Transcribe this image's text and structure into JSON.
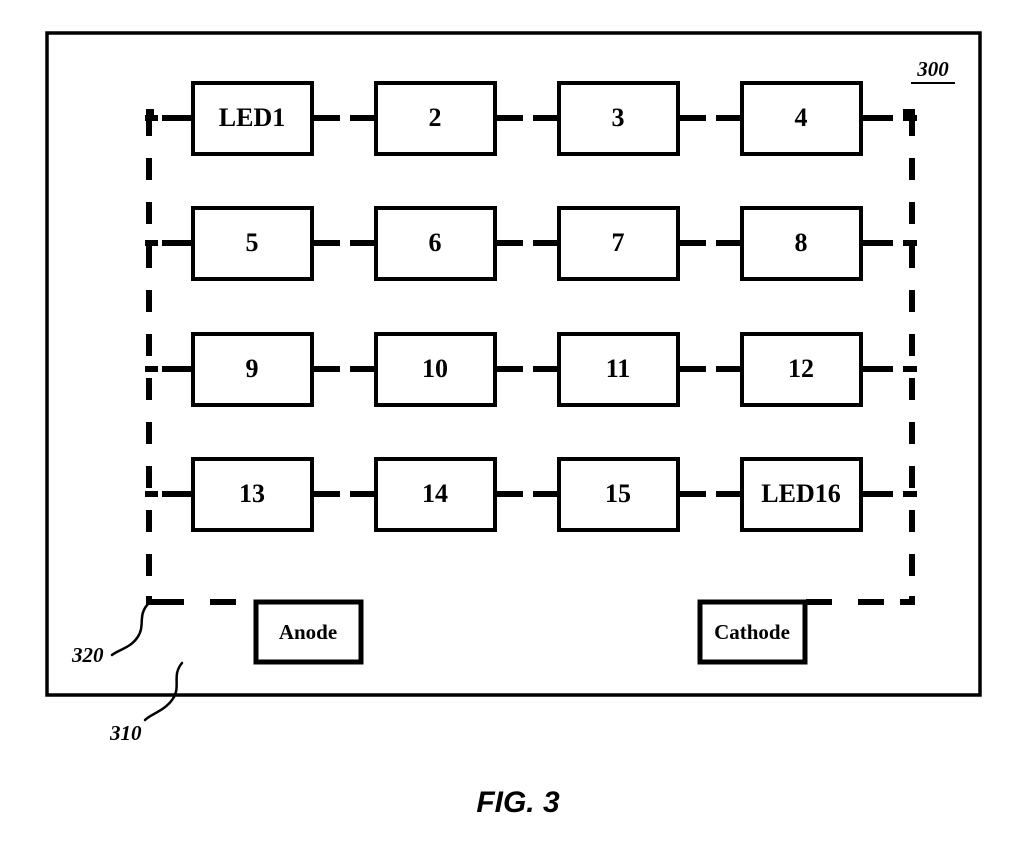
{
  "figure": {
    "caption": "FIG. 3",
    "assembly_ref": "300",
    "board_ref": "310",
    "circuit_ref": "320"
  },
  "led_array": {
    "rows": [
      [
        {
          "label": "LED1"
        },
        {
          "label": "2"
        },
        {
          "label": "3"
        },
        {
          "label": "4"
        }
      ],
      [
        {
          "label": "5"
        },
        {
          "label": "6"
        },
        {
          "label": "7"
        },
        {
          "label": "8"
        }
      ],
      [
        {
          "label": "9"
        },
        {
          "label": "10"
        },
        {
          "label": "11"
        },
        {
          "label": "12"
        }
      ],
      [
        {
          "label": "13"
        },
        {
          "label": "14"
        },
        {
          "label": "15"
        },
        {
          "label": "LED16"
        }
      ]
    ]
  },
  "terminals": {
    "anode": "Anode",
    "cathode": "Cathode"
  },
  "colors": {
    "line": "#000000",
    "background": "#ffffff",
    "box_fill": "#ffffff"
  }
}
